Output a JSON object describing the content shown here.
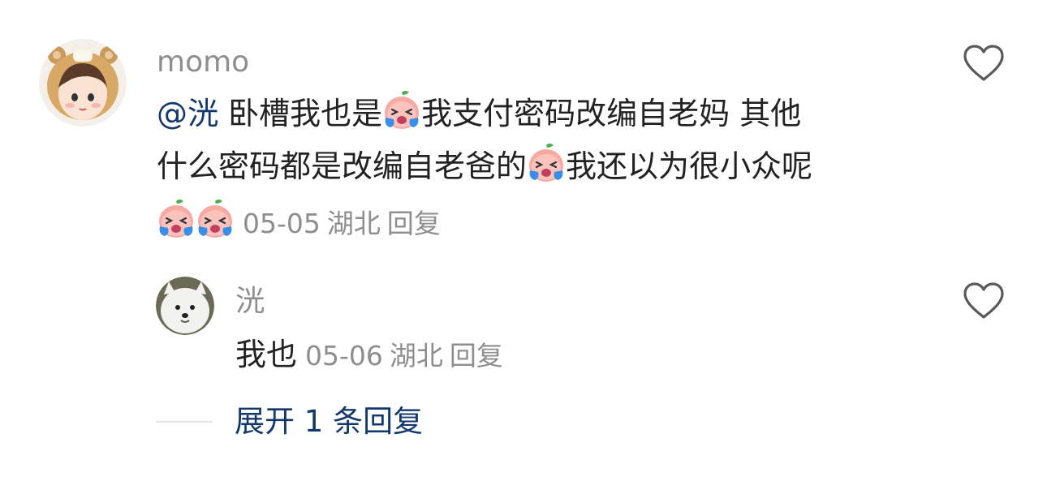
{
  "comment": {
    "username": "momo",
    "mention": "@洸",
    "line1_text_a": " 卧槽我也是",
    "line1_text_b": "我支付密码改编自老妈 其他",
    "line2_text_a": "什么密码都是改编自老爸的",
    "line2_text_b": "我还以为很小众呢",
    "emoji_name": "crying-peach-emoji",
    "date": "05-05",
    "location": "湖北",
    "reply_label": "回复"
  },
  "reply": {
    "username": "洸",
    "text": "我也",
    "date": "05-06",
    "location": "湖北",
    "reply_label": "回复"
  },
  "expand_label": "展开 1 条回复",
  "colors": {
    "link": "#13386c",
    "meta_gray": "#8e8e8e",
    "text": "#222222",
    "icon_gray": "#5a5a5a"
  }
}
